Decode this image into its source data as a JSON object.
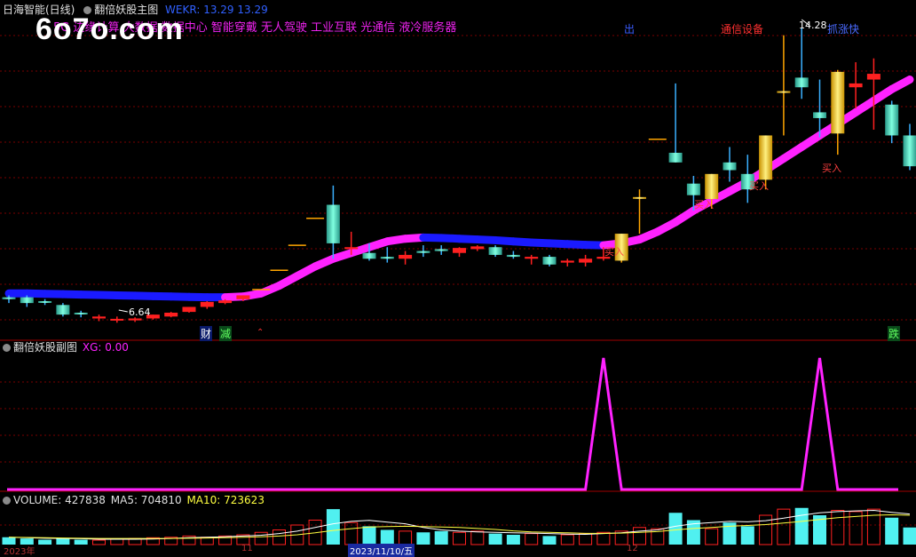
{
  "main_panel": {
    "stock_name": "日海智能(日线)",
    "indicator_name": "翻倍妖股主图",
    "weekr_label": "WEKR: 13.29 13.29",
    "sector_text": "5G 边缘计算 大数据 数据中心 智能穿戴 无人驾驶 工业互联 光通信 液冷服务器",
    "top_labels": {
      "out": "出",
      "telecom": "通信设备",
      "max": "14.28",
      "profit": "抓涨快"
    },
    "min_label": "6.64",
    "buy_label": "买入",
    "bottom_tags": {
      "cai": "财",
      "jian": "减",
      "die": "跌"
    }
  },
  "watermark": "6o7o.com",
  "sub_panel": {
    "indicator_name": "翻倍妖股副图",
    "value_label": "XG: 0.00"
  },
  "volume_panel": {
    "volume_label": "VOLUME: 427838",
    "ma5_label": "MA5: 704810",
    "ma10_label": "MA10: 723623"
  },
  "date_axis": {
    "start": "2023年",
    "m11": "11",
    "cursor_date": "2023/11/10/五",
    "m12": "12"
  },
  "colors": {
    "up": "#ff2020",
    "down": "#40e0c0",
    "gold": "#ffd700",
    "ribbon_blue": "#1a1aff",
    "ribbon_pink": "#ff22ff",
    "grid": "#7a0000"
  },
  "chart_data": [
    {
      "type": "candlestick",
      "name": "main",
      "candles": [
        {
          "o": 7.3,
          "h": 7.35,
          "l": 7.15,
          "c": 7.25
        },
        {
          "o": 7.3,
          "h": 7.35,
          "l": 7.05,
          "c": 7.15
        },
        {
          "o": 7.2,
          "h": 7.25,
          "l": 7.1,
          "c": 7.18
        },
        {
          "o": 7.1,
          "h": 7.15,
          "l": 6.8,
          "c": 6.85
        },
        {
          "o": 6.9,
          "h": 6.95,
          "l": 6.78,
          "c": 6.88
        },
        {
          "o": 6.75,
          "h": 6.85,
          "l": 6.68,
          "c": 6.8
        },
        {
          "o": 6.72,
          "h": 6.8,
          "l": 6.64,
          "c": 6.74
        },
        {
          "o": 6.7,
          "h": 6.78,
          "l": 6.66,
          "c": 6.75
        },
        {
          "o": 6.75,
          "h": 6.85,
          "l": 6.72,
          "c": 6.85
        },
        {
          "o": 6.8,
          "h": 6.92,
          "l": 6.78,
          "c": 6.9
        },
        {
          "o": 6.92,
          "h": 7.05,
          "l": 6.9,
          "c": 7.05
        },
        {
          "o": 7.05,
          "h": 7.2,
          "l": 7.0,
          "c": 7.18
        },
        {
          "o": 7.15,
          "h": 7.25,
          "l": 7.12,
          "c": 7.22
        },
        {
          "o": 7.25,
          "h": 7.35,
          "l": 7.2,
          "c": 7.35
        },
        {
          "o": 7.5,
          "h": 7.5,
          "l": 7.5,
          "c": 7.5
        },
        {
          "o": 8.0,
          "h": 8.0,
          "l": 8.0,
          "c": 8.0
        },
        {
          "o": 8.65,
          "h": 8.65,
          "l": 8.65,
          "c": 8.65
        },
        {
          "o": 9.35,
          "h": 9.35,
          "l": 9.35,
          "c": 9.35
        },
        {
          "o": 9.7,
          "h": 10.2,
          "l": 8.3,
          "c": 8.7
        },
        {
          "o": 8.55,
          "h": 9.0,
          "l": 8.4,
          "c": 8.6
        },
        {
          "o": 8.45,
          "h": 8.7,
          "l": 8.25,
          "c": 8.3
        },
        {
          "o": 8.35,
          "h": 8.6,
          "l": 8.2,
          "c": 8.3
        },
        {
          "o": 8.3,
          "h": 8.5,
          "l": 8.15,
          "c": 8.4
        },
        {
          "o": 8.5,
          "h": 8.65,
          "l": 8.35,
          "c": 8.45
        },
        {
          "o": 8.55,
          "h": 8.65,
          "l": 8.4,
          "c": 8.5
        },
        {
          "o": 8.45,
          "h": 8.6,
          "l": 8.35,
          "c": 8.58
        },
        {
          "o": 8.55,
          "h": 8.65,
          "l": 8.5,
          "c": 8.62
        },
        {
          "o": 8.6,
          "h": 8.65,
          "l": 8.35,
          "c": 8.4
        },
        {
          "o": 8.4,
          "h": 8.5,
          "l": 8.3,
          "c": 8.35
        },
        {
          "o": 8.3,
          "h": 8.4,
          "l": 8.15,
          "c": 8.35
        },
        {
          "o": 8.35,
          "h": 8.4,
          "l": 8.1,
          "c": 8.15
        },
        {
          "o": 8.2,
          "h": 8.3,
          "l": 8.1,
          "c": 8.25
        },
        {
          "o": 8.2,
          "h": 8.4,
          "l": 8.1,
          "c": 8.3
        },
        {
          "o": 8.3,
          "h": 8.6,
          "l": 8.25,
          "c": 8.35
        },
        {
          "o": 8.25,
          "h": 8.95,
          "l": 8.2,
          "c": 8.95,
          "g": 1
        },
        {
          "o": 9.9,
          "h": 10.1,
          "l": 8.95,
          "c": 9.9,
          "g": 1
        },
        {
          "o": 11.4,
          "h": 11.4,
          "l": 11.4,
          "c": 11.4
        },
        {
          "o": 11.05,
          "h": 12.85,
          "l": 10.8,
          "c": 10.8
        },
        {
          "o": 10.25,
          "h": 10.45,
          "l": 9.55,
          "c": 9.95
        },
        {
          "o": 9.85,
          "h": 10.5,
          "l": 9.6,
          "c": 10.5,
          "g": 1
        },
        {
          "o": 10.8,
          "h": 11.2,
          "l": 10.3,
          "c": 10.6
        },
        {
          "o": 10.5,
          "h": 11.0,
          "l": 9.75,
          "c": 10.1
        },
        {
          "o": 10.35,
          "h": 11.5,
          "l": 10.1,
          "c": 11.5,
          "g": 1
        },
        {
          "o": 12.65,
          "h": 14.1,
          "l": 11.5,
          "c": 12.65,
          "g": 1
        },
        {
          "o": 13.0,
          "h": 14.28,
          "l": 12.45,
          "c": 12.75
        },
        {
          "o": 12.1,
          "h": 12.95,
          "l": 11.45,
          "c": 11.95
        },
        {
          "o": 11.55,
          "h": 13.2,
          "l": 11.0,
          "c": 13.15,
          "g": 1
        },
        {
          "o": 12.75,
          "h": 13.4,
          "l": 12.2,
          "c": 12.85
        },
        {
          "o": 12.95,
          "h": 13.5,
          "l": 11.65,
          "c": 13.1
        },
        {
          "o": 12.3,
          "h": 12.4,
          "l": 11.3,
          "c": 11.5
        },
        {
          "o": 11.5,
          "h": 11.8,
          "l": 10.6,
          "c": 10.7
        }
      ],
      "ribbon": [
        7.4,
        7.4,
        7.39,
        7.38,
        7.37,
        7.36,
        7.35,
        7.34,
        7.33,
        7.32,
        7.31,
        7.3,
        7.3,
        7.32,
        7.4,
        7.6,
        7.85,
        8.1,
        8.3,
        8.45,
        8.6,
        8.75,
        8.82,
        8.85,
        8.84,
        8.82,
        8.8,
        8.78,
        8.75,
        8.72,
        8.7,
        8.68,
        8.66,
        8.65,
        8.7,
        8.8,
        9.0,
        9.25,
        9.55,
        9.8,
        10.05,
        10.3,
        10.6,
        10.9,
        11.2,
        11.5,
        11.8,
        12.1,
        12.4,
        12.7,
        12.95
      ],
      "ylim": [
        6.3,
        14.6
      ]
    },
    {
      "type": "line",
      "name": "XG",
      "points": [
        [
          0,
          0
        ],
        [
          32,
          0
        ],
        [
          33,
          1
        ],
        [
          34,
          0
        ],
        [
          44,
          0
        ],
        [
          45,
          1
        ],
        [
          46,
          0
        ],
        [
          50,
          0
        ]
      ],
      "ylim": [
        0,
        1
      ]
    },
    {
      "type": "bar",
      "name": "VOLUME",
      "values": [
        0.3,
        0.25,
        0.2,
        0.25,
        0.2,
        0.18,
        0.22,
        0.25,
        0.28,
        0.3,
        0.35,
        0.3,
        0.35,
        0.4,
        0.5,
        0.6,
        0.8,
        1.0,
        1.45,
        0.9,
        0.75,
        0.6,
        0.55,
        0.5,
        0.55,
        0.5,
        0.55,
        0.45,
        0.4,
        0.45,
        0.35,
        0.4,
        0.45,
        0.5,
        0.55,
        0.7,
        0.65,
        1.3,
        1.0,
        0.65,
        0.9,
        0.75,
        1.2,
        1.45,
        1.5,
        1.2,
        1.4,
        1.35,
        1.45,
        1.1,
        0.7
      ],
      "ma5": [
        0.3,
        0.28,
        0.26,
        0.25,
        0.24,
        0.22,
        0.22,
        0.22,
        0.23,
        0.25,
        0.28,
        0.3,
        0.32,
        0.35,
        0.38,
        0.45,
        0.55,
        0.7,
        0.85,
        0.95,
        0.99,
        0.92,
        0.85,
        0.7,
        0.6,
        0.55,
        0.52,
        0.5,
        0.48,
        0.47,
        0.45,
        0.43,
        0.42,
        0.45,
        0.48,
        0.55,
        0.6,
        0.75,
        0.85,
        0.9,
        0.95,
        0.93,
        0.98,
        1.08,
        1.2,
        1.3,
        1.35,
        1.38,
        1.4,
        1.32,
        1.25
      ],
      "ma10": [
        0.3,
        0.29,
        0.28,
        0.27,
        0.26,
        0.25,
        0.25,
        0.25,
        0.25,
        0.25,
        0.26,
        0.27,
        0.28,
        0.3,
        0.32,
        0.35,
        0.4,
        0.48,
        0.58,
        0.65,
        0.72,
        0.74,
        0.75,
        0.74,
        0.72,
        0.7,
        0.66,
        0.62,
        0.56,
        0.52,
        0.5,
        0.48,
        0.46,
        0.46,
        0.47,
        0.5,
        0.53,
        0.6,
        0.66,
        0.7,
        0.75,
        0.78,
        0.82,
        0.88,
        0.95,
        1.03,
        1.1,
        1.15,
        1.2,
        1.22,
        1.2
      ],
      "ylim": [
        0,
        1.6
      ]
    }
  ]
}
